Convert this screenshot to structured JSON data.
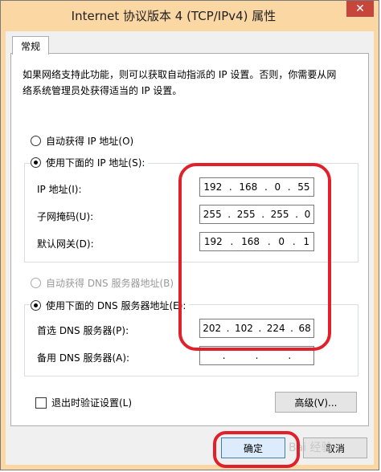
{
  "window": {
    "title": "Internet 协议版本 4 (TCP/IPv4) 属性",
    "close_glyph": "✕"
  },
  "tab": {
    "label": "常规"
  },
  "description": "如果网络支持此功能，则可以获取自动指派的 IP 设置。否则，你需要从网络系统管理员处获得适当的 IP 设置。",
  "ip_mode": {
    "auto_label": "自动获得 IP 地址(O)",
    "manual_label": "使用下面的 IP 地址(S):",
    "selected": "manual"
  },
  "ip_fields": [
    {
      "label": "IP 地址(I):",
      "octets": [
        "192",
        "168",
        "0",
        "55"
      ]
    },
    {
      "label": "子网掩码(U):",
      "octets": [
        "255",
        "255",
        "255",
        "0"
      ]
    },
    {
      "label": "默认网关(D):",
      "octets": [
        "192",
        "168",
        "0",
        "1"
      ]
    }
  ],
  "dns_mode": {
    "auto_label": "自动获得 DNS 服务器地址(B)",
    "manual_label": "使用下面的 DNS 服务器地址(E):",
    "selected": "manual",
    "auto_disabled": true
  },
  "dns_fields": [
    {
      "label": "首选 DNS 服务器(P):",
      "octets": [
        "202",
        "102",
        "224",
        "68"
      ]
    },
    {
      "label": "备用 DNS 服务器(A):",
      "octets": [
        "",
        "",
        "",
        ""
      ]
    }
  ],
  "validate_checkbox": {
    "label": "退出时验证设置(L)",
    "checked": false
  },
  "buttons": {
    "advanced": "高级(V)...",
    "ok": "确定",
    "cancel": "取消"
  },
  "watermark": "Bai 经验",
  "colors": {
    "titlebar": "#fbd7a3",
    "close": "#c7463c",
    "annotation": "#e0202a"
  }
}
